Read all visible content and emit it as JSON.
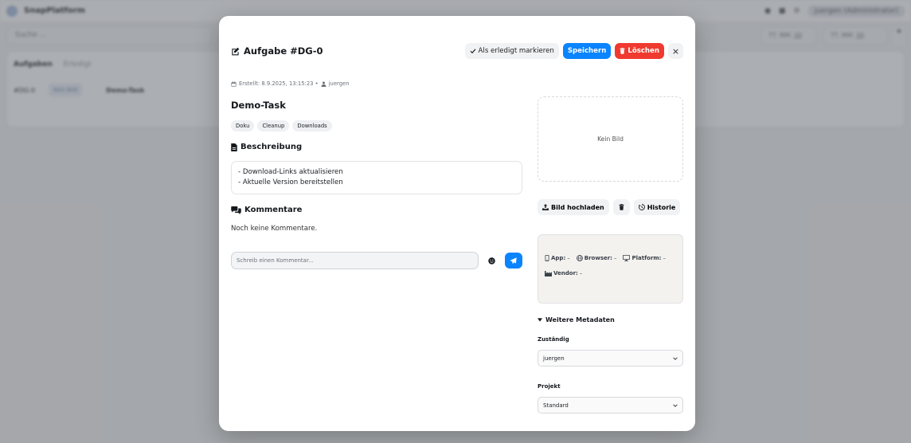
{
  "background": {
    "brand": "SnapPlatform",
    "search_placeholder": "Suche ...",
    "tabs": [
      "Aufgaben",
      "Erledigt"
    ],
    "row_id": "#DG-0",
    "row_bild": "Kein Bild",
    "row_title": "Demo-Task",
    "user_chip": "juergen (Administrator)",
    "date_a": "TT. MM. JJJJ",
    "date_b": "TT. MM. JJJJ"
  },
  "modal": {
    "title": "Aufgabe #DG-0",
    "mark_done_label": "Als erledigt markieren",
    "save_label": "Speichern",
    "delete_label": "Löschen",
    "close_label": "×",
    "meta_created": "Erstellt: 8.9.2025, 13:15:23 •",
    "meta_user": "juergen",
    "task_title": "Demo-Task",
    "tags": [
      "Doku",
      "Cleanup",
      "Downloads"
    ],
    "description_heading": "Beschreibung",
    "description_text": "- Download-Links aktualisieren\n- Aktuelle Version bereitstellen",
    "comments_heading": "Kommentare",
    "no_comments": "Noch keine Kommentare.",
    "comment_placeholder": "Schreib einen Kommentar...",
    "image_placeholder": "Kein Bild",
    "upload_label": "Bild hochladen",
    "history_label": "Historie",
    "meta": {
      "app_label": "App:",
      "app_value": "–",
      "browser_label": "Browser:",
      "browser_value": "–",
      "platform_label": "Platform:",
      "platform_value": "–",
      "vendor_label": "Vendor:",
      "vendor_value": "–"
    },
    "more_meta_label": "Weitere Metadaten",
    "assignee_label": "Zuständig",
    "assignee_value": "juergen",
    "project_label": "Projekt",
    "project_value": "Standard"
  },
  "colors": {
    "primary": "#0a84ff",
    "danger": "#f03a2f"
  }
}
